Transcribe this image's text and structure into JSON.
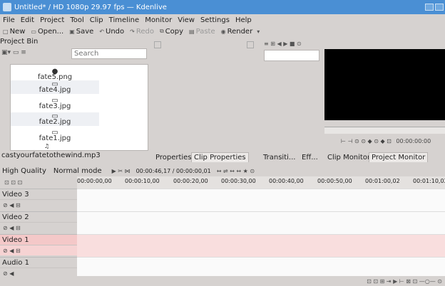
{
  "window": {
    "title": "Untitled* / HD 1080p 29.97 fps — Kdenlive"
  },
  "menu": [
    "File",
    "Edit",
    "Project",
    "Tool",
    "Clip",
    "Timeline",
    "Monitor",
    "View",
    "Settings",
    "Help"
  ],
  "toolbar": {
    "new": "New",
    "open": "Open...",
    "save": "Save",
    "undo": "Undo",
    "redo": "Redo",
    "copy": "Copy",
    "paste": "Paste",
    "render": "Render"
  },
  "project_bin": {
    "title": "Project Bin",
    "search_placeholder": "Search",
    "items": [
      "fate5.png",
      "fate4.jpg",
      "fate3.jpg",
      "fate2.jpg",
      "fate1.jpg",
      "castyourfatetothewind.mp3"
    ]
  },
  "tabs": {
    "properties": "Properties",
    "clip_properties": "Clip Properties",
    "transitions": "Transiti...",
    "effects": "Eff...",
    "clip_monitor": "Clip Monitor",
    "project_monitor": "Project Monitor"
  },
  "monitor": {
    "timecode": "00:00:00:00"
  },
  "timeline_toolbar": {
    "quality": "High Quality",
    "mode": "Normal mode",
    "position": "00:00:46,17 / 00:00:00,01"
  },
  "ruler": [
    "00:00:00,00",
    "00:00:10,00",
    "00:00:20,00",
    "00:00:30,00",
    "00:00:40,00",
    "00:00:50,00",
    "00:01:00,02",
    "00:01:10,02"
  ],
  "tracks": [
    "Video 3",
    "Video 2",
    "Video 1",
    "Audio 1"
  ]
}
